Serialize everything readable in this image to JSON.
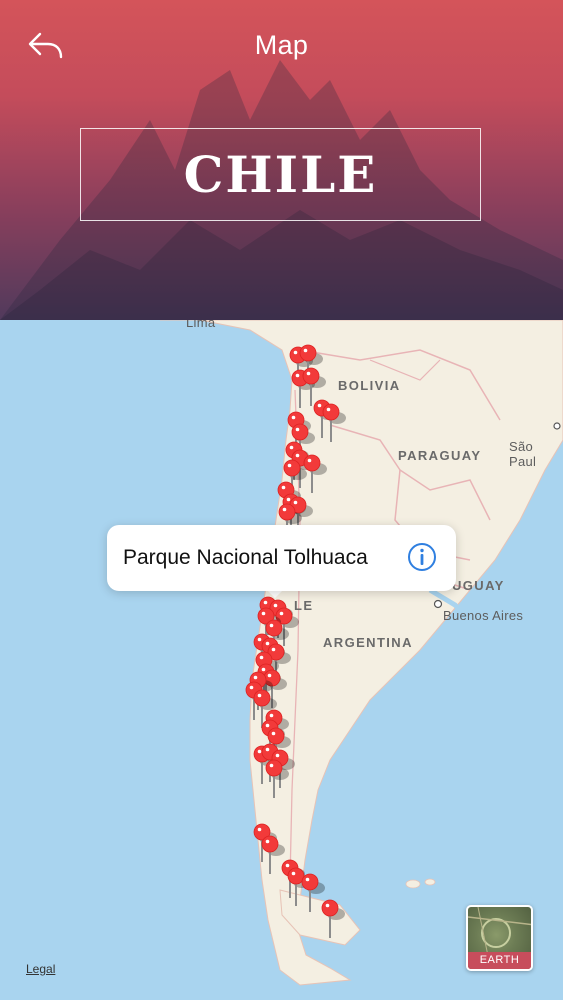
{
  "header": {
    "title": "Map",
    "banner": "CHILE"
  },
  "icons": {
    "back": "reply-arrow-icon",
    "info": "info-circle-icon"
  },
  "map": {
    "labels": {
      "lima": "Lima",
      "bolivia": "BOLIVIA",
      "paraguay": "PARAGUAY",
      "sao_paulo": "São Paul",
      "uruguay": "UGUAY",
      "chile": "LE",
      "buenos_aires": "Buenos Aires",
      "argentina": "ARGENTINA"
    },
    "callout": {
      "title": "Parque Nacional Tolhuaca"
    },
    "map_type_button": "EARTH",
    "legal": "Legal"
  },
  "colors": {
    "accent": "#c74d5c",
    "pin": "#f23a3a",
    "ocean": "#a9d4ef",
    "land": "#f4efe2",
    "info_blue": "#2f7fe0"
  }
}
